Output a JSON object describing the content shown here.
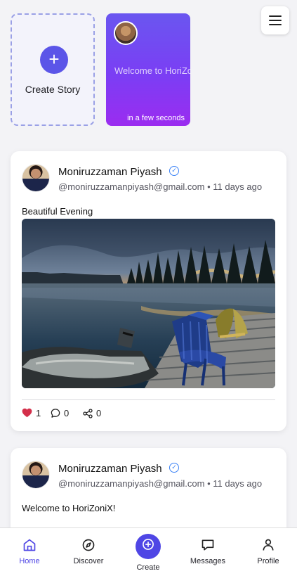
{
  "stories": {
    "create_label": "Create Story",
    "create_icon": "plus-icon",
    "card": {
      "preview_text": "Welcome to HoriZoniX!",
      "time_text": "in a few seconds"
    }
  },
  "header": {
    "menu_icon": "hamburger-menu-icon"
  },
  "posts": [
    {
      "author": "Moniruzzaman Piyash",
      "email": "@moniruzzamanpiyash@gmail.com",
      "time": "11 days ago",
      "meta": "@moniruzzamanpiyash@gmail.com • 11 days ago",
      "text": "Beautiful Evening",
      "likes": "1",
      "comments": "0",
      "shares": "0"
    },
    {
      "author": "Moniruzzaman Piyash",
      "email": "@moniruzzamanpiyash@gmail.com",
      "time": "11 days ago",
      "meta": "@moniruzzamanpiyash@gmail.com • 11 days ago",
      "text": "Welcome to HoriZoniX!"
    }
  ],
  "nav": {
    "items": [
      {
        "label": "Home",
        "icon": "home-icon"
      },
      {
        "label": "Discover",
        "icon": "compass-icon"
      },
      {
        "label": "Create",
        "icon": "plus-circle-icon"
      },
      {
        "label": "Messages",
        "icon": "message-icon"
      },
      {
        "label": "Profile",
        "icon": "user-icon"
      }
    ]
  },
  "colors": {
    "accent": "#4f46e5",
    "story_gradient_start": "#6a56f0",
    "story_gradient_end": "#9b2cf0",
    "like": "#d32f4a",
    "verified": "#3b82f6"
  }
}
